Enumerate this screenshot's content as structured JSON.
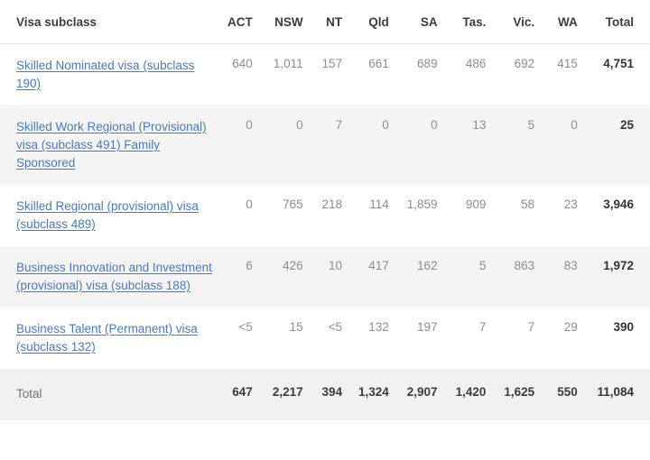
{
  "table": {
    "columns": [
      "Visa subclass",
      "ACT",
      "NSW",
      "NT",
      "Qld",
      "SA",
      "Tas.",
      "Vic.",
      "WA",
      "Total"
    ],
    "rows": [
      {
        "label_lines": [
          "Skilled Nominated visa (subclass 190)"
        ],
        "label": "Skilled Nominated visa (subclass 190)",
        "is_link": true,
        "values": [
          "640",
          "1,011",
          "157",
          "661",
          "689",
          "486",
          "692",
          "415"
        ],
        "total": "4,751"
      },
      {
        "label_lines": [
          "Skilled Work Regional (Provisional) visa (subclass 491) Family Sponsored"
        ],
        "label": "Skilled Work Regional (Provisional) visa (subclass 491) Family Sponsored",
        "is_link": true,
        "values": [
          "0",
          "0",
          "7",
          "0",
          "0",
          "13",
          "5",
          "0"
        ],
        "total": "25"
      },
      {
        "label_lines": [
          "Skilled Regional (provisional) visa (subclass 489)"
        ],
        "label": "Skilled Regional (provisional) visa (subclass 489)",
        "is_link": true,
        "values": [
          "0",
          "765",
          "218",
          "114",
          "1,859",
          "909",
          "58",
          "23"
        ],
        "total": "3,946"
      },
      {
        "label_lines": [
          "Business Innovation and Investment (provisional) visa (subclass 188)"
        ],
        "label": "Business Innovation and Investment (provisional) visa (subclass 188)",
        "is_link": true,
        "values": [
          "6",
          "426",
          "10",
          "417",
          "162",
          "5",
          "863",
          "83"
        ],
        "total": "1,972"
      },
      {
        "label_lines": [
          "Business Talent (Permanent) visa (subclass 132)"
        ],
        "label": "Business Talent (Permanent) visa (subclass 132)",
        "is_link": true,
        "values": [
          "<5",
          "15",
          "<5",
          "132",
          "197",
          "7",
          "7",
          "29"
        ],
        "total": "390"
      }
    ],
    "total_row": {
      "label": "Total",
      "values": [
        "647",
        "2,217",
        "394",
        "1,324",
        "2,907",
        "1,420",
        "1,625",
        "550"
      ],
      "total": "11,084"
    }
  },
  "colors": {
    "link": "#4a7ab5",
    "stripe": "#f4f4f4",
    "total_row_bg": "#f1f1f1",
    "header_text": "#3c3c3c",
    "cell_text": "#8d8d8d",
    "total_text": "#333333",
    "border": "#e6e6e6"
  }
}
